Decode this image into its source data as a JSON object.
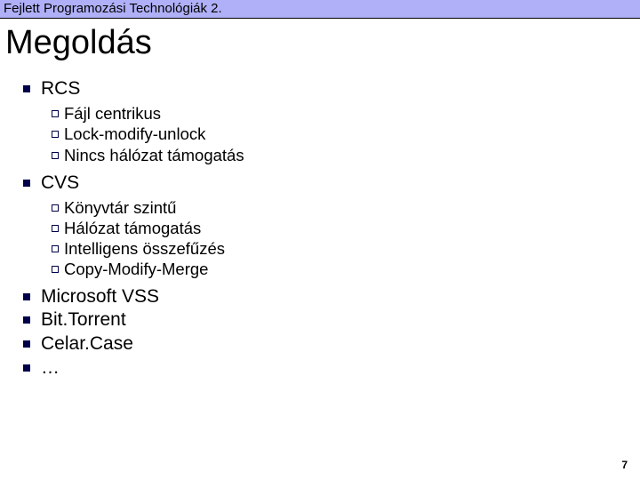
{
  "header": "Fejlett Programozási Technológiák 2.",
  "title": "Megoldás",
  "items": [
    {
      "label": "RCS",
      "sub": [
        "Fájl centrikus",
        "Lock-modify-unlock",
        "Nincs hálózat támogatás"
      ]
    },
    {
      "label": "CVS",
      "sub": [
        "Könyvtár szintű",
        "Hálózat támogatás",
        "Intelligens összefűzés",
        "Copy-Modify-Merge"
      ]
    },
    {
      "label": "Microsoft VSS",
      "sub": []
    },
    {
      "label": "Bit.Torrent",
      "sub": []
    },
    {
      "label": "Celar.Case",
      "sub": []
    },
    {
      "label": "…",
      "sub": []
    }
  ],
  "page_number": "7"
}
